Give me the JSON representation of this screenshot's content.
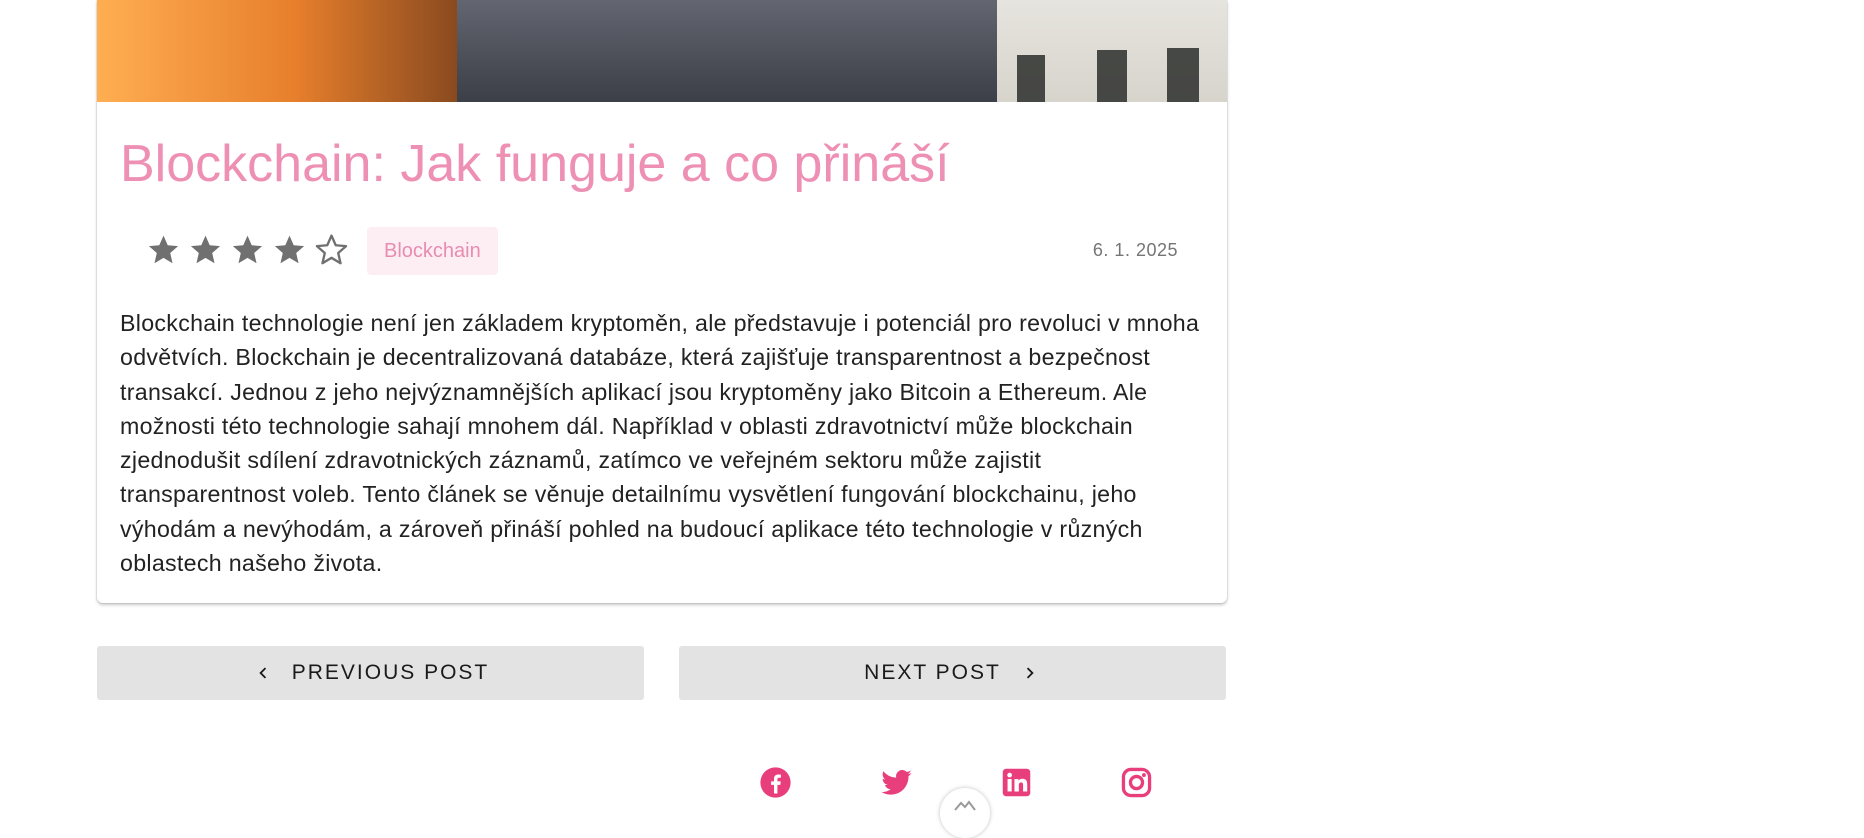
{
  "article": {
    "title": "Blockchain: Jak funguje a co přináší",
    "rating": {
      "value": 4,
      "max": 5
    },
    "tag": "Blockchain",
    "date": "6. 1. 2025",
    "body": "Blockchain technologie není jen základem kryptoměn, ale představuje i potenciál pro revoluci v mnoha odvětvích. Blockchain je decentralizovaná databáze, která zajišťuje transparentnost a bezpečnost transakcí. Jednou z jeho nejvýznamnějších aplikací jsou kryptoměny jako Bitcoin a Ethereum. Ale možnosti této technologie sahají mnohem dál. Například v oblasti zdravotnictví může blockchain zjednodušit sdílení zdravotnických záznamů, zatímco ve veřejném sektoru může zajistit transparentnost voleb. Tento článek se věnuje detailnímu vysvětlení fungování blockchainu, jeho výhodám a nevýhodám, a zároveň přináší pohled na budoucí aplikace této technologie v různých oblastech našeho života."
  },
  "navigation": {
    "previous_label": "PREVIOUS POST",
    "next_label": "NEXT POST"
  },
  "social": [
    {
      "name": "facebook",
      "icon": "facebook-icon"
    },
    {
      "name": "twitter",
      "icon": "twitter-icon"
    },
    {
      "name": "linkedin",
      "icon": "linkedin-icon"
    },
    {
      "name": "instagram",
      "icon": "instagram-icon"
    }
  ],
  "colors": {
    "accent_pink": "#ee8fb4",
    "social_pink": "#e83e7c",
    "tag_bg": "#fdeef4",
    "button_bg": "#e3e3e3",
    "star_grey": "#707070"
  }
}
